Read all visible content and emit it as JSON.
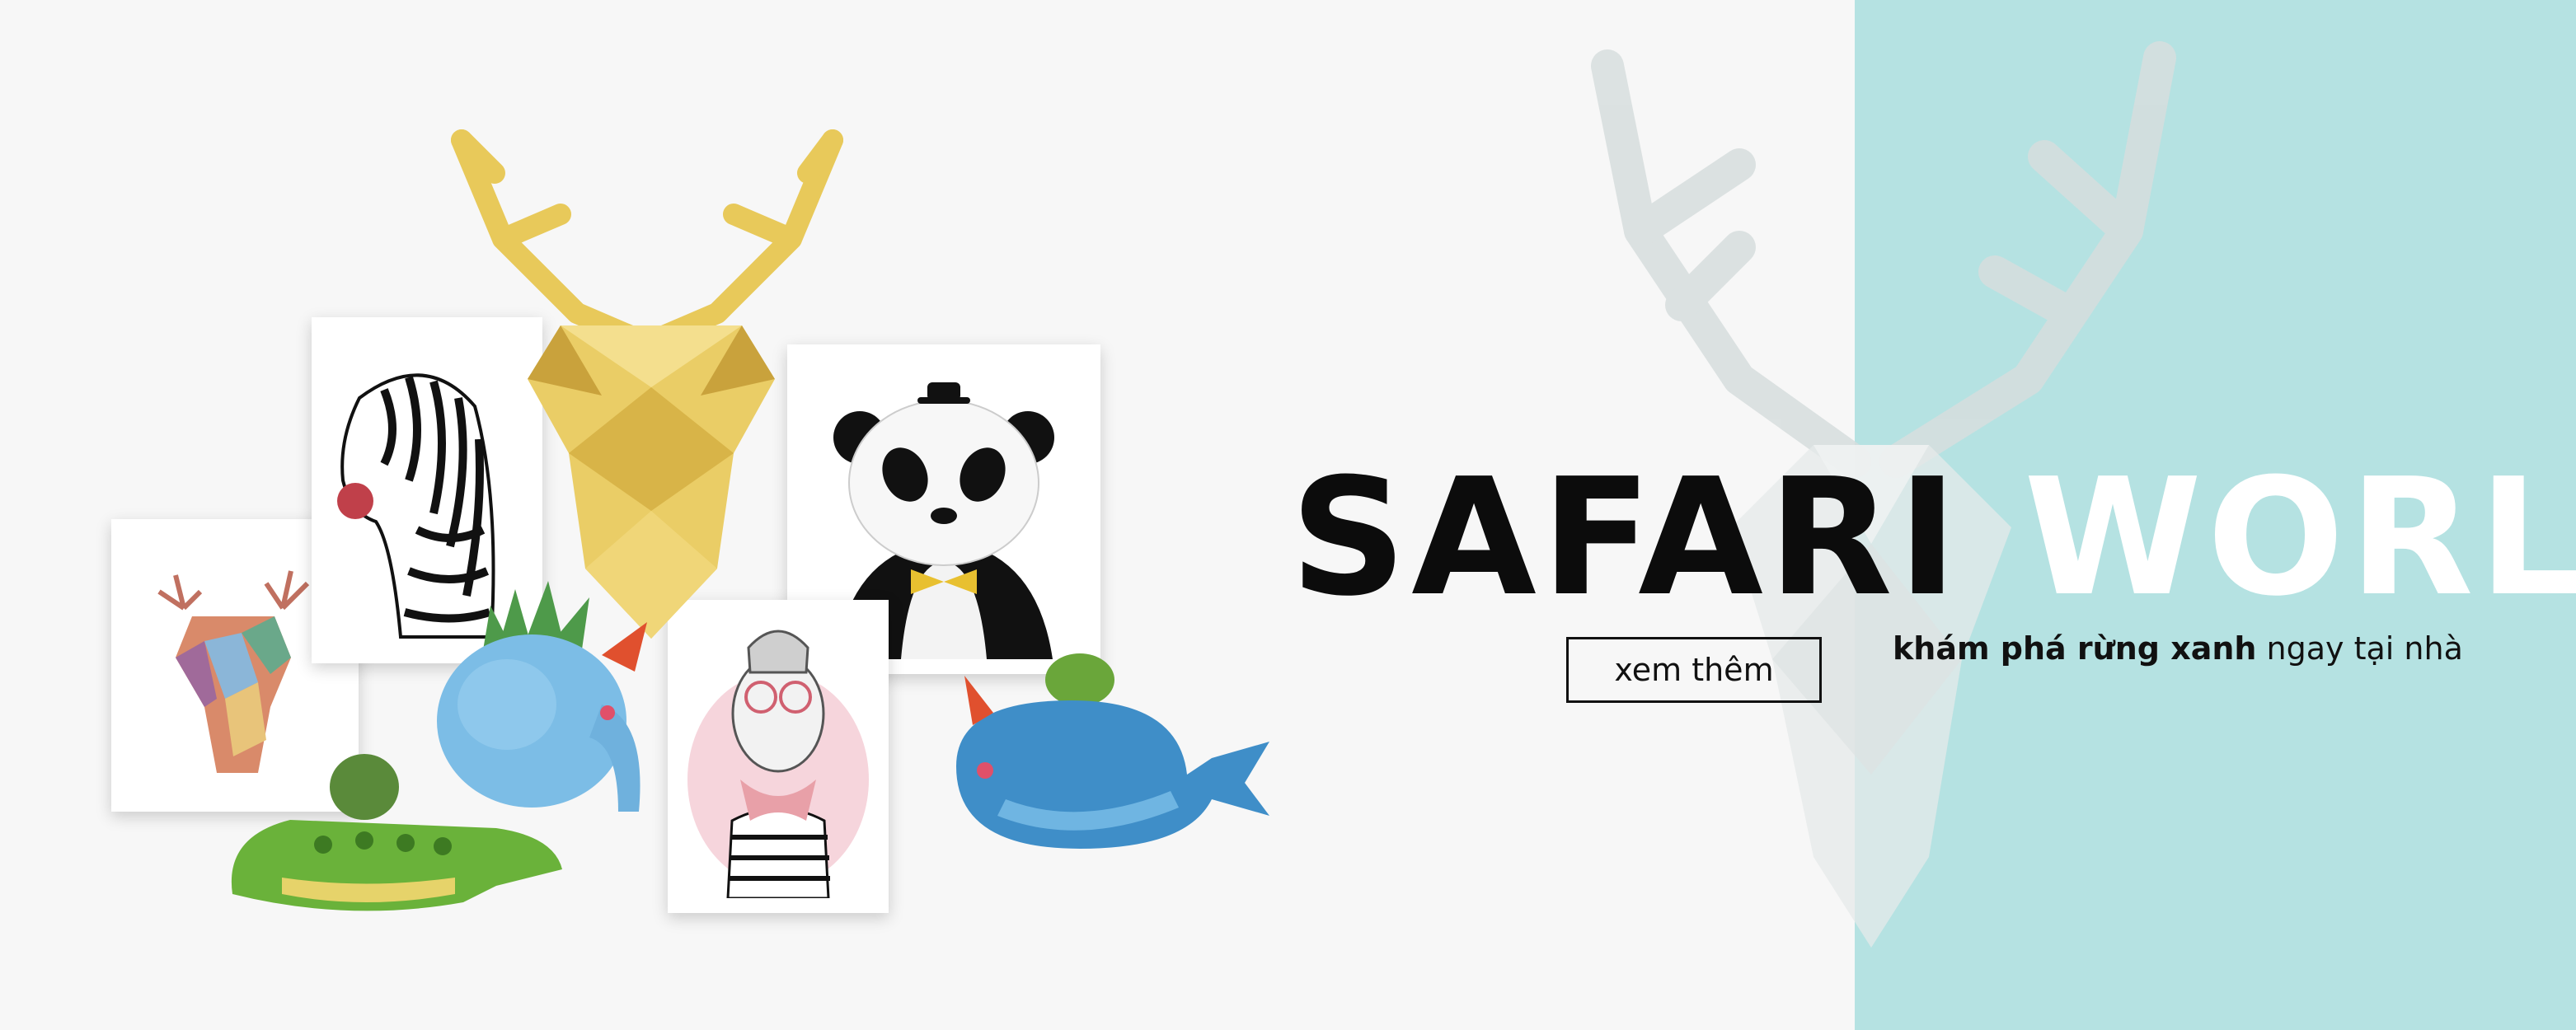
{
  "headline": {
    "word1": "SAFARI",
    "word2": "WORLD"
  },
  "cta": {
    "label": "xem thêm"
  },
  "tagline": {
    "bold": "khám phá rừng xanh",
    "regular": " ngay tại nhà"
  },
  "colors": {
    "teal_panel": "#b5e2e2",
    "background": "#f7f7f7",
    "headline_dark": "#0c0c0c",
    "headline_light": "#ffffff",
    "gold": "#e8c95a"
  }
}
